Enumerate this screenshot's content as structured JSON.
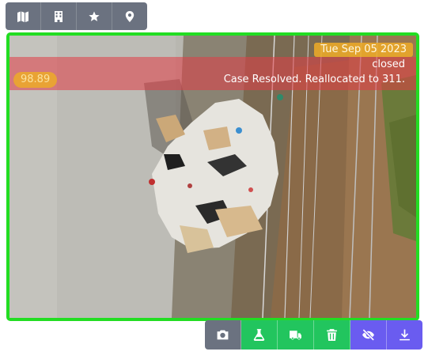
{
  "top_toolbar": {
    "buttons": [
      {
        "name": "map",
        "icon": "map-icon"
      },
      {
        "name": "building",
        "icon": "building-icon"
      },
      {
        "name": "star",
        "icon": "star-icon"
      },
      {
        "name": "location",
        "icon": "map-pin-icon"
      }
    ]
  },
  "image_card": {
    "date": "Tue Sep 05 2023",
    "status": "closed",
    "notes": "Case Resolved. Reallocated to 311.",
    "score": "98.89",
    "border_color": "#22dd22"
  },
  "bottom_toolbar": {
    "buttons": [
      {
        "name": "camera",
        "icon": "camera-icon",
        "color": "#6b7280"
      },
      {
        "name": "lab",
        "icon": "flask-icon",
        "color": "#22c55e"
      },
      {
        "name": "truck",
        "icon": "truck-icon",
        "color": "#22c55e"
      },
      {
        "name": "delete",
        "icon": "trash-icon",
        "color": "#22c55e"
      },
      {
        "name": "hide",
        "icon": "eye-slash-icon",
        "color": "#6a5cf0"
      },
      {
        "name": "download",
        "icon": "download-icon",
        "color": "#6a5cf0"
      }
    ]
  }
}
